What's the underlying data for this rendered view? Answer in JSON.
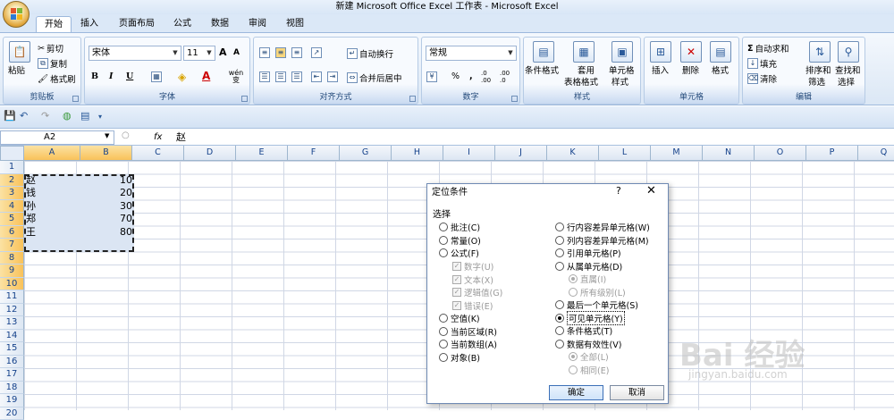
{
  "window": {
    "title": "新建 Microsoft Office Excel 工作表 - Microsoft Excel"
  },
  "tabs": [
    "开始",
    "插入",
    "页面布局",
    "公式",
    "数据",
    "审阅",
    "视图"
  ],
  "active_tab": "开始",
  "ribbon": {
    "clipboard": {
      "label": "剪贴板",
      "paste": "粘贴",
      "cut": "剪切",
      "copy": "复制",
      "format_painter": "格式刷"
    },
    "font": {
      "label": "字体",
      "name": "宋体",
      "size": "11",
      "bold": "B",
      "italic": "I",
      "underline": "U",
      "grow": "A",
      "shrink": "A",
      "phonetic": "wén 变"
    },
    "alignment": {
      "label": "对齐方式",
      "wrap_text": "自动换行",
      "merge_center": "合并后居中"
    },
    "number": {
      "label": "数字",
      "format": "常规",
      "percent": "%",
      "comma": ",",
      "inc_decimal": ".0 .00",
      "dec_decimal": ".00 .0"
    },
    "styles": {
      "label": "样式",
      "conditional_format": "条件格式",
      "format_table": "套用",
      "format_table2": "表格格式",
      "cell_styles": "单元格",
      "cell_styles2": "样式"
    },
    "cells": {
      "label": "单元格",
      "insert": "插入",
      "delete": "删除",
      "format": "格式"
    },
    "editing": {
      "label": "编辑",
      "autosum": "自动求和",
      "fill": "填充",
      "clear": "清除",
      "sort_filter": "排序和",
      "sort_filter2": "筛选",
      "find_select": "查找和",
      "find_select2": "选择"
    }
  },
  "formula_bar": {
    "name_box": "A2",
    "fx": "fx",
    "value": "赵"
  },
  "columns": [
    "A",
    "B",
    "C",
    "D",
    "E",
    "F",
    "G",
    "H",
    "I",
    "J",
    "K",
    "L",
    "M",
    "N",
    "O",
    "P",
    "Q"
  ],
  "rows": [
    "1",
    "2",
    "3",
    "4",
    "5",
    "6",
    "7",
    "8",
    "9",
    "10",
    "11",
    "12",
    "13",
    "14",
    "15",
    "16",
    "17",
    "18",
    "19",
    "20"
  ],
  "cells": [
    {
      "name": "赵",
      "value": "10"
    },
    {
      "name": "钱",
      "value": "20"
    },
    {
      "name": "孙",
      "value": "30"
    },
    {
      "name": "郑",
      "value": "70"
    },
    {
      "name": "王",
      "value": "80"
    }
  ],
  "dialog": {
    "title": "定位条件",
    "help": "?",
    "close": "✕",
    "select_label": "选择",
    "left_options": [
      "批注(C)",
      "常量(O)",
      "公式(F)"
    ],
    "formula_sub": [
      "数字(U)",
      "文本(X)",
      "逻辑值(G)",
      "错误(E)"
    ],
    "left_options2": [
      "空值(K)",
      "当前区域(R)",
      "当前数组(A)",
      "对象(B)"
    ],
    "right_options": [
      "行内容差异单元格(W)",
      "列内容差异单元格(M)",
      "引用单元格(P)",
      "从属单元格(D)"
    ],
    "dependents_sub": [
      "直属(I)",
      "所有级别(L)"
    ],
    "right_options2": [
      "最后一个单元格(S)",
      "可见单元格(Y)",
      "条件格式(T)",
      "数据有效性(V)"
    ],
    "validation_sub": [
      "全部(L)",
      "相同(E)"
    ],
    "selected": "可见单元格(Y)",
    "ok": "确定",
    "cancel": "取消"
  },
  "watermark": {
    "brand": "Bai 经验",
    "url": "jingyan.baidu.com"
  }
}
